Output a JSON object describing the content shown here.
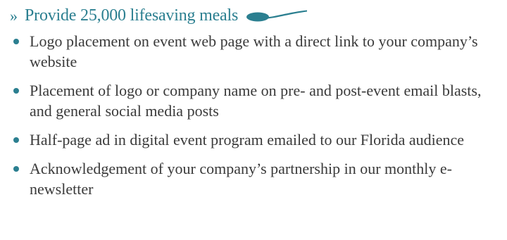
{
  "heading": {
    "marker": "»",
    "title": "Provide 25,000 lifesaving meals",
    "spoon_icon": "spoon-icon",
    "accent_color": "#2b7f90"
  },
  "benefits": [
    "Logo placement on event web page with a direct link to your company’s website",
    "Placement of logo or company name on pre- and post-event email blasts, and general social media posts",
    "Half-page ad in digital event program emailed to our Florida audience",
    "Acknowledgement of your company’s partnership in our monthly e-newsletter"
  ]
}
